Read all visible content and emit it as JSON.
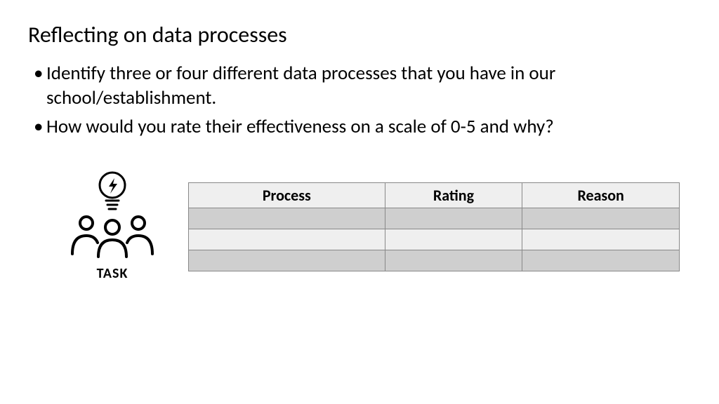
{
  "title": "Reflecting on data processes",
  "bullets": [
    "Identify three or four different data processes that you have in our school/establishment.",
    "How would you rate their effectiveness on a scale of 0-5 and why?"
  ],
  "task": {
    "label": "TASK"
  },
  "table": {
    "headers": {
      "process": "Process",
      "rating": "Rating",
      "reason": "Reason"
    },
    "rows": [
      {
        "process": "",
        "rating": "",
        "reason": ""
      },
      {
        "process": "",
        "rating": "",
        "reason": ""
      },
      {
        "process": "",
        "rating": "",
        "reason": ""
      }
    ]
  }
}
